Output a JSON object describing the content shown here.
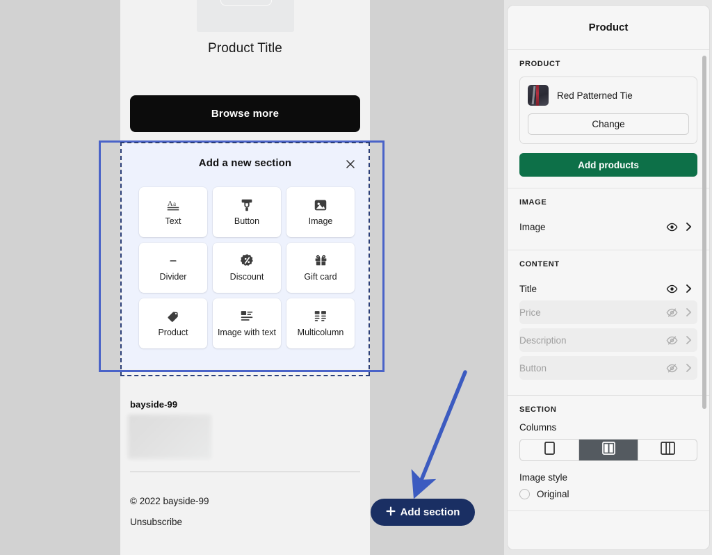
{
  "canvas": {
    "email": {
      "product_title": "Product Title",
      "browse_more_label": "Browse more",
      "brand_name": "bayside-99",
      "copyright": "© 2022 bayside-99",
      "unsubscribe": "Unsubscribe"
    },
    "add_section_popover": {
      "title": "Add a new section",
      "close_icon": "close-icon",
      "tiles": [
        {
          "label": "Text",
          "icon": "text-aa-icon"
        },
        {
          "label": "Button",
          "icon": "button-icon"
        },
        {
          "label": "Image",
          "icon": "image-icon"
        },
        {
          "label": "Divider",
          "icon": "divider-icon"
        },
        {
          "label": "Discount",
          "icon": "discount-badge-icon"
        },
        {
          "label": "Gift card",
          "icon": "gift-card-icon"
        },
        {
          "label": "Product",
          "icon": "product-tag-icon"
        },
        {
          "label": "Image with text",
          "icon": "image-with-text-icon"
        },
        {
          "label": "Multicolumn",
          "icon": "multicolumn-icon"
        }
      ]
    },
    "add_section_button": {
      "label": "Add section",
      "plus_icon": "plus-icon"
    },
    "annotation": {
      "arrow_icon": "arrow-pointing-down-left-icon",
      "arrow_color": "#3c5bc0"
    }
  },
  "right_panel": {
    "header_title": "Product",
    "product_section": {
      "label": "PRODUCT",
      "item_name": "Red Patterned Tie",
      "change_label": "Change",
      "add_products_label": "Add products",
      "add_products_color": "#0d7048"
    },
    "image_section": {
      "label": "IMAGE",
      "rows": [
        {
          "label": "Image",
          "visible": true,
          "eye_icon": "eye-icon",
          "chevron_icon": "chevron-right-icon"
        }
      ]
    },
    "content_section": {
      "label": "CONTENT",
      "rows": [
        {
          "label": "Title",
          "visible": true,
          "eye_icon": "eye-icon",
          "chevron_icon": "chevron-right-icon"
        },
        {
          "label": "Price",
          "visible": false,
          "eye_icon": "eye-off-icon",
          "chevron_icon": "chevron-right-icon"
        },
        {
          "label": "Description",
          "visible": false,
          "eye_icon": "eye-off-icon",
          "chevron_icon": "chevron-right-icon"
        },
        {
          "label": "Button",
          "visible": false,
          "eye_icon": "eye-off-icon",
          "chevron_icon": "chevron-right-icon"
        }
      ]
    },
    "section_section": {
      "label": "SECTION",
      "columns_label": "Columns",
      "columns_options": [
        {
          "name": "one-column",
          "selected": false
        },
        {
          "name": "two-column",
          "selected": true
        },
        {
          "name": "three-column",
          "selected": false
        }
      ],
      "image_style_label": "Image style",
      "image_style_options": [
        {
          "label": "Original",
          "selected": false
        }
      ]
    }
  }
}
